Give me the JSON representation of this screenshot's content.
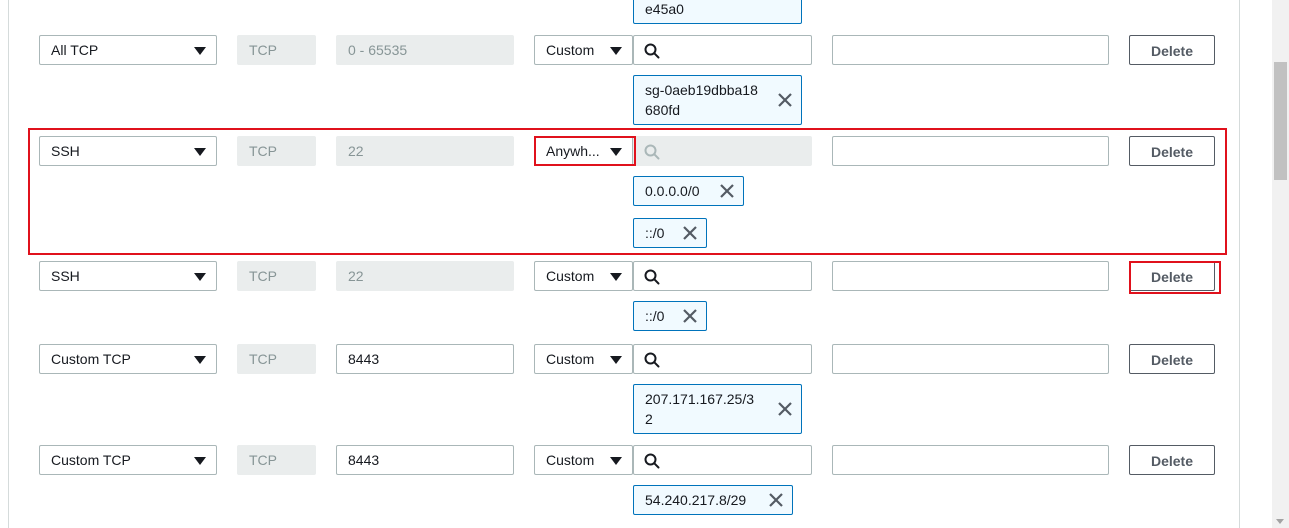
{
  "rules": [
    {
      "type": "",
      "protocol": "",
      "port_range": "",
      "source_type": "",
      "chips": [
        "e45a0"
      ],
      "description": ""
    },
    {
      "type": "All TCP",
      "protocol": "TCP",
      "port_range": "0 - 65535",
      "source_type": "Custom",
      "chips": [
        "sg-0aeb19dbba18",
        "680fd"
      ],
      "description": "",
      "delete_label": "Delete"
    },
    {
      "type": "SSH",
      "protocol": "TCP",
      "port_range": "22",
      "source_type": "Anywh...",
      "chips": [
        "0.0.0.0/0",
        "::/0"
      ],
      "description": "",
      "delete_label": "Delete"
    },
    {
      "type": "SSH",
      "protocol": "TCP",
      "port_range": "22",
      "source_type": "Custom",
      "chips": [
        "::/0"
      ],
      "description": "",
      "delete_label": "Delete"
    },
    {
      "type": "Custom TCP",
      "protocol": "TCP",
      "port_range": "8443",
      "source_type": "Custom",
      "chips": [
        "207.171.167.25/3",
        "2"
      ],
      "description": "",
      "delete_label": "Delete"
    },
    {
      "type": "Custom TCP",
      "protocol": "TCP",
      "port_range": "8443",
      "source_type": "Custom",
      "chips": [
        "54.240.217.8/29"
      ],
      "description": "",
      "delete_label": "Delete"
    }
  ],
  "colors": {
    "accent": "#0073bb",
    "chip_bg": "#f1faff",
    "highlight": "#e0111c",
    "disabled_bg": "#eaeded"
  },
  "icons": {
    "dropdown": "caret-down-icon",
    "search": "search-icon",
    "remove": "close-icon"
  }
}
